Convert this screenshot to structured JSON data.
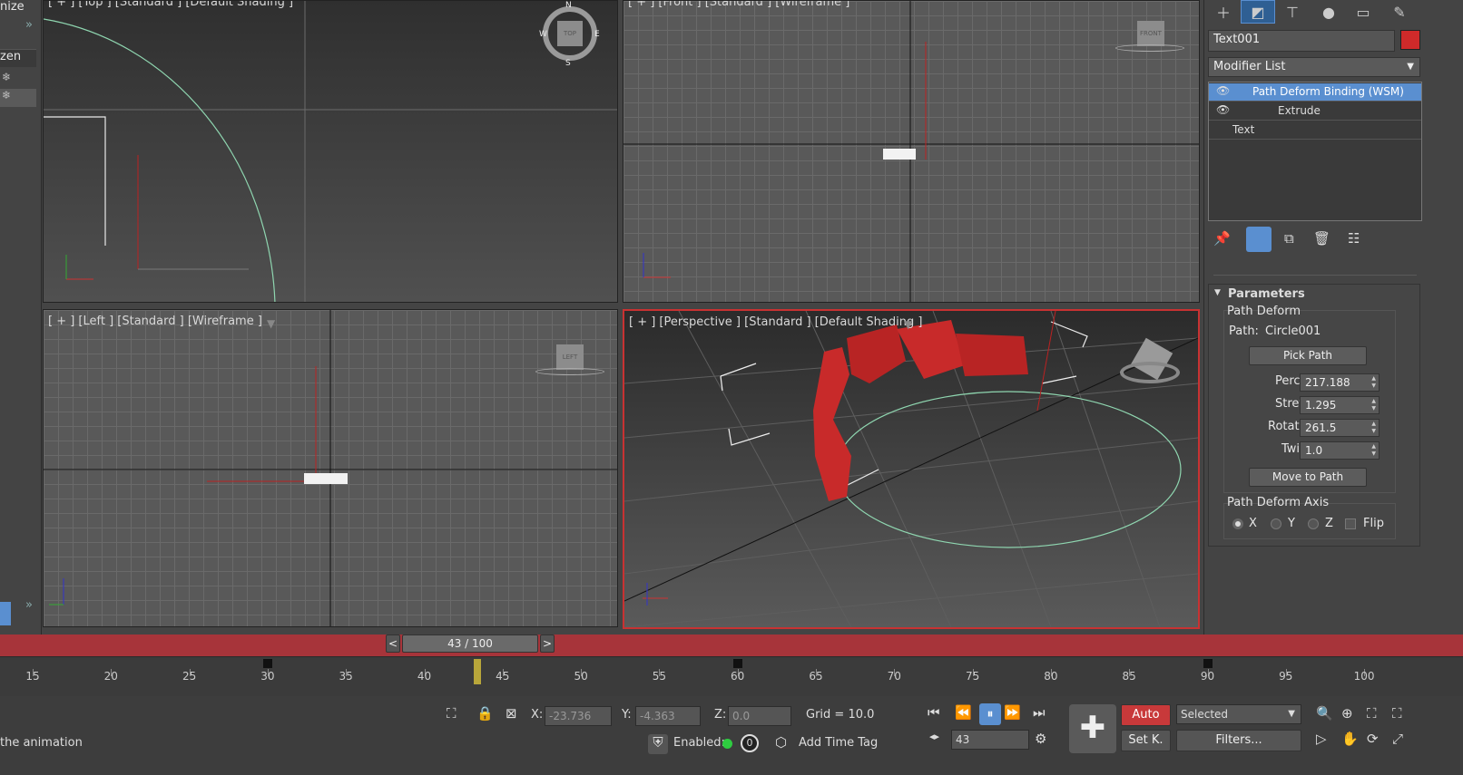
{
  "left_panel": {
    "title_fragment": "nize",
    "column_fragment": "zen",
    "chevron": "»"
  },
  "viewports": {
    "top": {
      "label": "[ + ] [Top ] [Standard ] [Default Shading ]"
    },
    "front": {
      "label": "[ + ] [Front ] [Standard ] [Wireframe ]"
    },
    "left": {
      "label": "[ + ] [Left ] [Standard ] [Wireframe ]"
    },
    "perspective": {
      "label": "[ + ] [Perspective ] [Standard ] [Default Shading ]"
    },
    "viewcube": {
      "top": "TOP",
      "front": "FRONT",
      "left": "LEFT",
      "n": "N",
      "s": "S",
      "e": "E",
      "w": "W"
    },
    "axes": {
      "x": "x",
      "y": "y",
      "z": "z"
    }
  },
  "command_panel": {
    "tabs": [
      "create-icon",
      "modify-icon",
      "hierarchy-icon",
      "motion-icon",
      "display-icon",
      "utilities-icon"
    ],
    "object_name": "Text001",
    "object_color": "#d02a2a",
    "modifier_list_label": "Modifier List",
    "stack": [
      {
        "label": "Path Deform Binding (WSM)",
        "selected": true
      },
      {
        "label": "Extrude",
        "selected": false
      },
      {
        "label": "Text",
        "selected": false
      }
    ],
    "rollout_title": "Parameters",
    "path_deform": {
      "group_label": "Path Deform",
      "path_label": "Path:",
      "path_value": "Circle001",
      "pick_path_label": "Pick Path",
      "percent_label": "Percent",
      "percent_value": "217.188",
      "stretch_label": "Stretch",
      "stretch_value": "1.295",
      "rotation_label": "Rotation",
      "rotation_value": "261.5",
      "twist_label": "Twist",
      "twist_value": "1.0",
      "move_to_path_label": "Move to Path",
      "axis_group_label": "Path Deform Axis",
      "axis_x": "X",
      "axis_y": "Y",
      "axis_z": "Z",
      "axis_selected": "X",
      "flip_label": "Flip"
    }
  },
  "timeline": {
    "frame_display": "43 / 100",
    "prev_label": "<",
    "next_label": ">",
    "current_frame": 43,
    "ticks": [
      "15",
      "20",
      "25",
      "30",
      "35",
      "40",
      "45",
      "50",
      "55",
      "60",
      "65",
      "70",
      "75",
      "80",
      "85",
      "90",
      "95",
      "100"
    ]
  },
  "status_bar": {
    "message": "the animation",
    "x_label": "X:",
    "x_value": "-23.736",
    "y_label": "Y:",
    "y_value": "-4.363",
    "z_label": "Z:",
    "z_value": "0.0",
    "grid_label": "Grid = 10.0",
    "enabled_label": "Enabled:",
    "enabled_count": "0",
    "add_time_tag": "Add Time Tag",
    "auto_label": "Auto",
    "setkey_label": "Set K.",
    "selected_label": "Selected",
    "filters_label": "Filters...",
    "frame_value": "43"
  },
  "colors": {
    "accent_red": "#a7343a",
    "selection_blue": "#5a8fd0",
    "text_red": "#c82a2a",
    "circle_green": "#8fd6b0"
  }
}
